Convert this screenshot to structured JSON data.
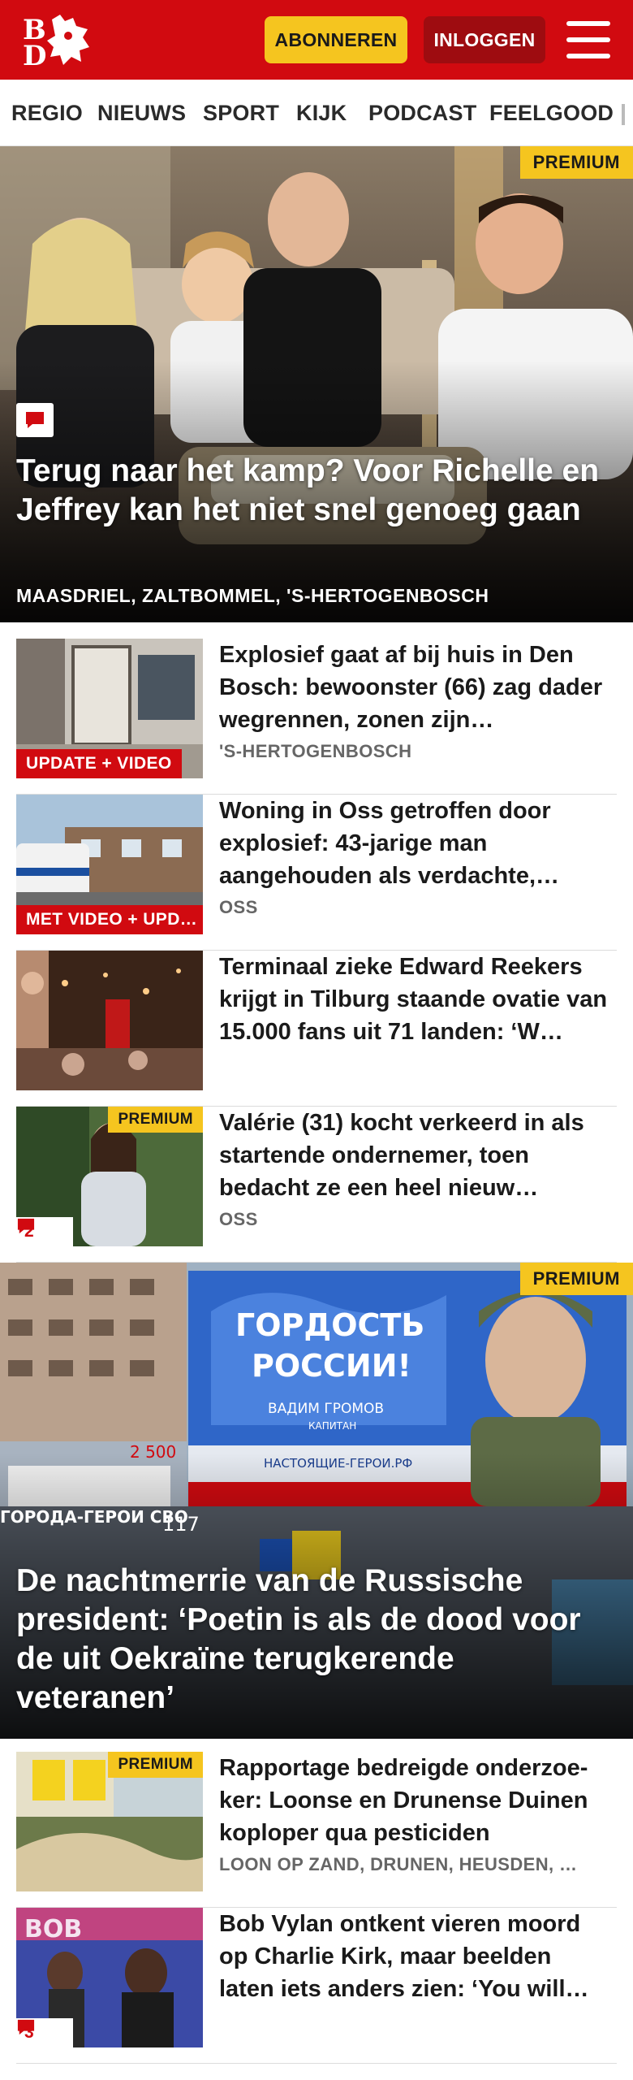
{
  "header": {
    "logo_text": "BD",
    "subscribe_label": "ABONNEREN",
    "login_label": "INLOGGEN",
    "menu_icon": "hamburger-icon"
  },
  "nav": {
    "items": [
      "REGIO",
      "NIEUWS",
      "SPORT",
      "KIJK",
      "PODCAST",
      "FEELGOOD"
    ]
  },
  "hero1": {
    "premium": "PREMIUM",
    "title": "Terug naar het kamp? Voor Richelle en Jeffrey kan het niet snel genoeg gaan",
    "location": "MAASDRIEL, ZALTBOMMEL, 'S-HERTOGENBOSCH"
  },
  "list1": [
    {
      "label": "UPDATE + VIDEO",
      "title": "Explosief gaat af bij huis in Den Bosch: bewoonster (66) zag dader wegrennen, zonen zijn…",
      "location": "'S-HERTOGENBOSCH"
    },
    {
      "label": "MET VIDEO + UPD…",
      "title": "Woning in Oss getroffen door explosief: 43-jarige man aangehouden als verdachte,…",
      "location": "OSS"
    },
    {
      "title": "Terminaal zieke Edward Reekers krijgt in Tilburg staande ovatie van 15.000 fans uit 71 landen: ‘W…"
    },
    {
      "premium": "PREMIUM",
      "comments": "2",
      "title": "Valérie (31) kocht verkeerd in als startende ondernemer, toen bedacht ze een heel nieuw…",
      "location": "OSS"
    }
  ],
  "hero2": {
    "premium": "PREMIUM",
    "title": "De nachtmerrie van de Russische president: ‘Poetin is als de dood voor de uit Oekraïne terugkerende veteranen’",
    "billboard_line1": "ГОРДОСТЬ",
    "billboard_line2": "РОССИИ!",
    "billboard_name": "ВАДИМ ГРОМОВ",
    "billboard_sub": "КАПИТАН",
    "billboard_url": "НАСТОЯЩИЕ-ГЕРОИ.РФ",
    "left_sign": "ГОРОДА-ГЕРОИ СВО",
    "left_number": "2 500",
    "bus_number": "117"
  },
  "list2": [
    {
      "premium": "PREMIUM",
      "title": "Rapportage bedreigde onderzoe­ker: Loonse en Drunense Duinen koploper qua pesticiden",
      "location": "LOON OP ZAND, DRUNEN, HEUSDEN, …"
    },
    {
      "comments": "3",
      "title": "Bob Vylan ontkent vieren moord op Charlie Kirk, maar beelden laten iets anders zien: ‘You will…",
      "thumb_text": "BOB"
    }
  ],
  "colors": {
    "brand_red": "#d10a10",
    "premium_yellow": "#f5c51f",
    "login_dark_red": "#9e0c10"
  }
}
